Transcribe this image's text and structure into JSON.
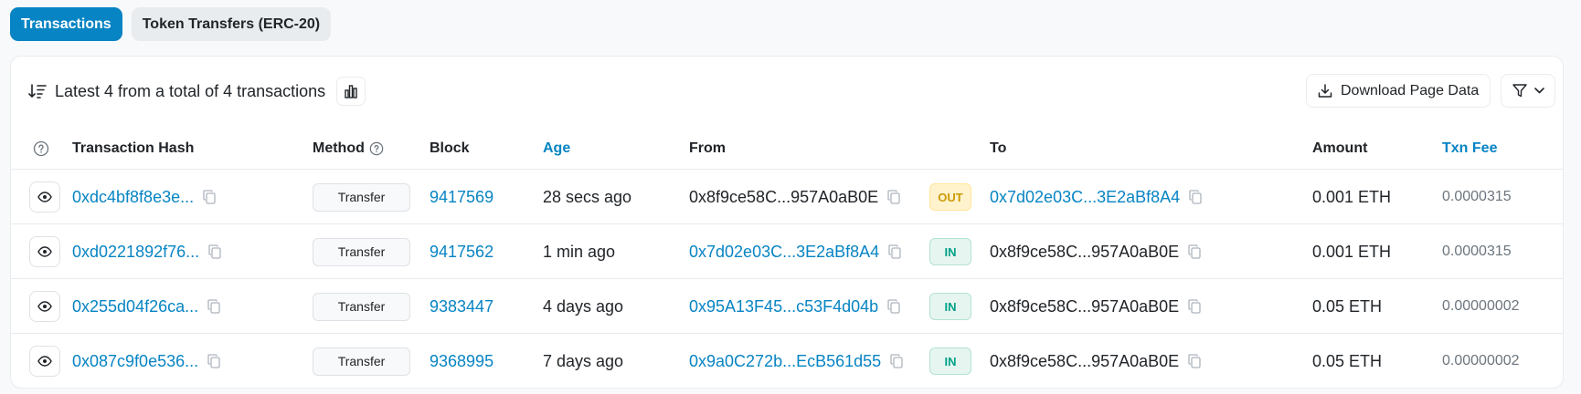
{
  "tabs": [
    {
      "label": "Transactions",
      "active": true
    },
    {
      "label": "Token Transfers (ERC-20)",
      "active": false
    }
  ],
  "summary": {
    "text": "Latest 4 from a total of 4 transactions"
  },
  "toolbar": {
    "download_label": "Download Page Data"
  },
  "columns": {
    "hash": "Transaction Hash",
    "method": "Method",
    "block": "Block",
    "age": "Age",
    "from": "From",
    "to": "To",
    "amount": "Amount",
    "fee": "Txn Fee"
  },
  "rows": [
    {
      "hash": "0xdc4bf8f8e3e...",
      "method": "Transfer",
      "block": "9417569",
      "age": "28 secs ago",
      "from": "0x8f9ce58C...957A0aB0E",
      "from_link": false,
      "direction": "OUT",
      "to": "0x7d02e03C...3E2aBf8A4",
      "to_link": true,
      "amount": "0.001 ETH",
      "fee": "0.0000315"
    },
    {
      "hash": "0xd0221892f76...",
      "method": "Transfer",
      "block": "9417562",
      "age": "1 min ago",
      "from": "0x7d02e03C...3E2aBf8A4",
      "from_link": true,
      "direction": "IN",
      "to": "0x8f9ce58C...957A0aB0E",
      "to_link": false,
      "amount": "0.001 ETH",
      "fee": "0.0000315"
    },
    {
      "hash": "0x255d04f26ca...",
      "method": "Transfer",
      "block": "9383447",
      "age": "4 days ago",
      "from": "0x95A13F45...c53F4d04b",
      "from_link": true,
      "direction": "IN",
      "to": "0x8f9ce58C...957A0aB0E",
      "to_link": false,
      "amount": "0.05 ETH",
      "fee": "0.00000002"
    },
    {
      "hash": "0x087c9f0e536...",
      "method": "Transfer",
      "block": "9368995",
      "age": "7 days ago",
      "from": "0x9a0C272b...EcB561d55",
      "from_link": true,
      "direction": "IN",
      "to": "0x8f9ce58C...957A0aB0E",
      "to_link": false,
      "amount": "0.05 ETH",
      "fee": "0.00000002"
    }
  ],
  "colors": {
    "accent": "#0784c3",
    "out_badge": "#cc9a06",
    "in_badge": "#00a186",
    "muted": "#6c757d"
  }
}
